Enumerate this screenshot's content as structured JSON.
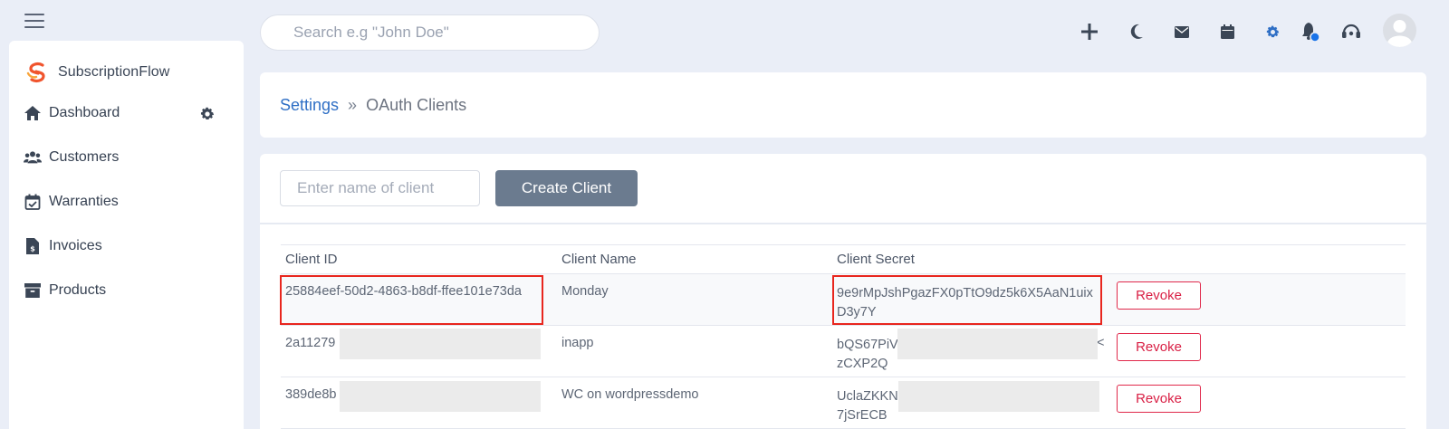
{
  "app": {
    "brand_name": "SubscriptionFlow"
  },
  "search": {
    "placeholder": "Search e.g \"John Doe\""
  },
  "sidebar": {
    "items": [
      {
        "label": "Dashboard",
        "icon": "home-icon"
      },
      {
        "label": "Customers",
        "icon": "users-icon"
      },
      {
        "label": "Warranties",
        "icon": "calendar-check-icon"
      },
      {
        "label": "Invoices",
        "icon": "invoice-icon"
      },
      {
        "label": "Products",
        "icon": "archive-icon"
      }
    ]
  },
  "topbar": {
    "icons": [
      "plus-icon",
      "moon-icon",
      "envelope-icon",
      "calendar-icon",
      "gear-icon",
      "bell-icon",
      "headset-icon",
      "avatar"
    ],
    "accent": "#2f6fc5"
  },
  "breadcrumb": {
    "parent": "Settings",
    "separator": "»",
    "current": "OAuth Clients"
  },
  "form": {
    "client_name_placeholder": "Enter name of client",
    "create_label": "Create Client"
  },
  "table": {
    "headers": {
      "id": "Client ID",
      "name": "Client Name",
      "secret": "Client Secret"
    },
    "rows": [
      {
        "id": "25884eef-50d2-4863-b8df-ffee101e73da",
        "name": "Monday",
        "secret": "9e9rMpJshPgazFX0pTtO9dz5k6X5AaN1uixD3y7Y",
        "action": "Revoke"
      },
      {
        "id": "2a11279",
        "name": "inapp",
        "secret_line1": "bQS67PiV",
        "secret_tail": "<",
        "secret_line2": "zCXP2Q",
        "action": "Revoke"
      },
      {
        "id": "389de8b",
        "name": "WC on wordpressdemo",
        "secret_line1": "UclaZKKN",
        "secret_line2": "7jSrECB",
        "action": "Revoke"
      }
    ]
  },
  "colors": {
    "highlight": "#e8261e",
    "revoke": "#d92045",
    "button": "#6b7b8f"
  }
}
